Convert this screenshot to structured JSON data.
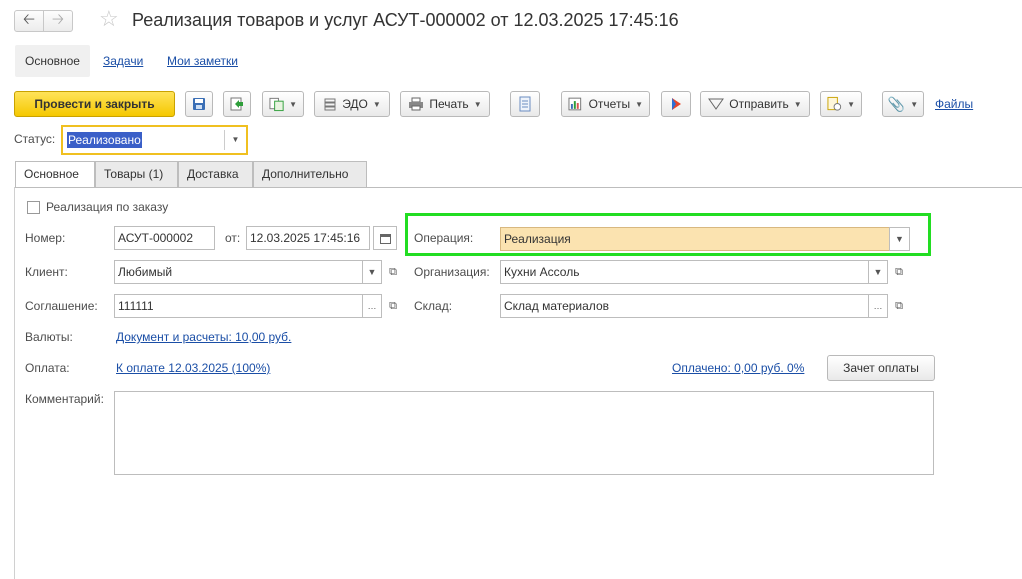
{
  "nav": {
    "back_icon": "arrow-left-icon",
    "forward_icon": "arrow-right-icon"
  },
  "title": "Реализация товаров и услуг АСУТ-000002 от 12.03.2025 17:45:16",
  "top_tabs": [
    "Основное",
    "Задачи",
    "Мои заметки"
  ],
  "toolbar": {
    "post_close": "Провести и закрыть",
    "edo": "ЭДО",
    "print": "Печать",
    "reports": "Отчеты",
    "send": "Отправить",
    "files": "Файлы"
  },
  "status": {
    "label": "Статус:",
    "value": "Реализовано"
  },
  "form_tabs": [
    "Основное",
    "Товары (1)",
    "Доставка",
    "Дополнительно"
  ],
  "form": {
    "by_order_label": "Реализация по заказу",
    "number_label": "Номер:",
    "number_value": "АСУТ-000002",
    "from_label": "от:",
    "date_value": "12.03.2025 17:45:16",
    "operation_label": "Операция:",
    "operation_value": "Реализация",
    "client_label": "Клиент:",
    "client_value": "Любимый",
    "org_label": "Организация:",
    "org_value": "Кухни Ассоль",
    "agreement_label": "Соглашение:",
    "agreement_value": "111111",
    "warehouse_label": "Склад:",
    "warehouse_value": "Склад материалов",
    "currency_label": "Валюты:",
    "currency_link": "Документ и расчеты: 10,00 руб.",
    "payment_label": "Оплата:",
    "payment_link": "К оплате 12.03.2025 (100%)",
    "paid_link": "Оплачено: 0,00 руб. 0%",
    "offset_button": "Зачет оплаты",
    "comment_label": "Комментарий:",
    "comment_value": ""
  },
  "colors": {
    "primary_button": "#f5c800",
    "highlight_frame": "#22dd22",
    "operation_bg": "#fbe3b0",
    "status_frame": "#f0c020",
    "link": "#1a4ea6"
  }
}
